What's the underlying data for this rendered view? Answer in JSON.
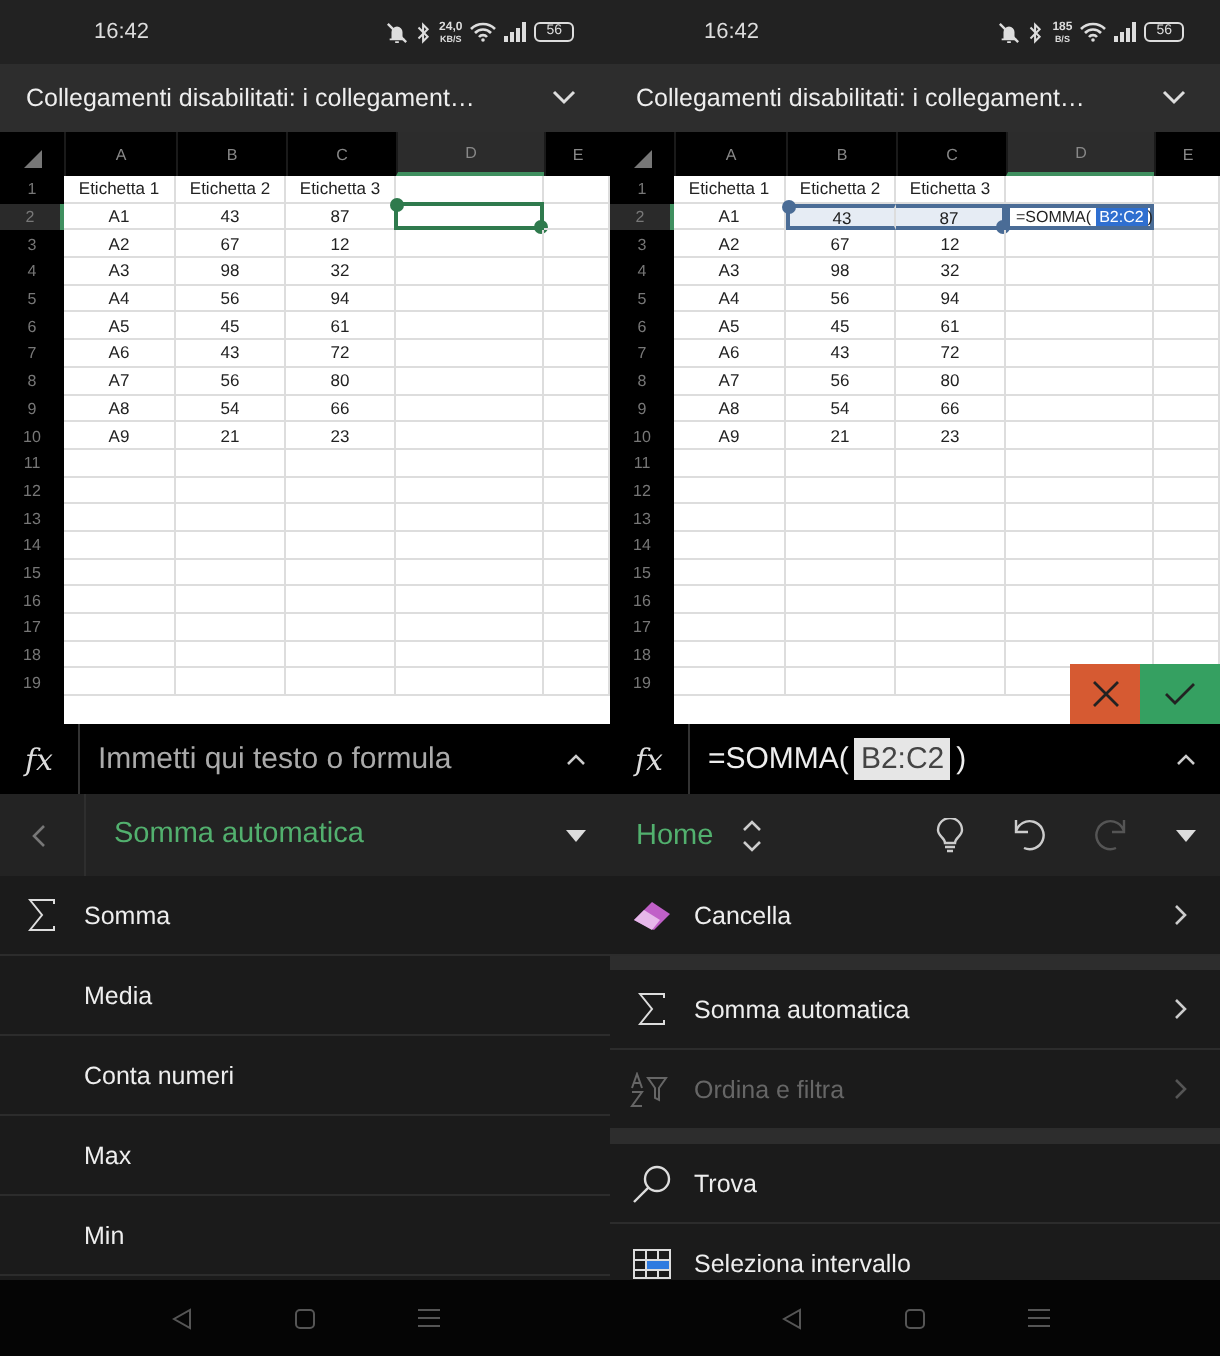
{
  "screens": [
    {
      "status_bar": {
        "time": "16:42",
        "speed_value": "24,0",
        "speed_unit": "KB/S",
        "battery": "56"
      },
      "banner": {
        "text": "Collegamenti disabilitati: i collegament…"
      },
      "sheet": {
        "editing": false,
        "columns": [
          {
            "label": "A",
            "selected": false
          },
          {
            "label": "B",
            "selected": false
          },
          {
            "label": "C",
            "selected": false
          },
          {
            "label": "D",
            "selected": true
          },
          {
            "label": "E",
            "selected": false
          }
        ],
        "rows": [
          {
            "number": "1",
            "selected": false,
            "cells": [
              {
                "text": "Etichetta 1",
                "selected": false
              },
              {
                "text": "Etichetta 2",
                "selected": false
              },
              {
                "text": "Etichetta 3",
                "selected": false
              }
            ]
          },
          {
            "number": "2",
            "selected": true,
            "cells": [
              {
                "text": "A1",
                "selected": false
              },
              {
                "text": "43",
                "selected": false
              },
              {
                "text": "87",
                "selected": false
              }
            ]
          },
          {
            "number": "3",
            "selected": false,
            "cells": [
              {
                "text": "A2",
                "selected": false
              },
              {
                "text": "67",
                "selected": false
              },
              {
                "text": "12",
                "selected": false
              }
            ]
          },
          {
            "number": "4",
            "selected": false,
            "cells": [
              {
                "text": "A3",
                "selected": false
              },
              {
                "text": "98",
                "selected": false
              },
              {
                "text": "32",
                "selected": false
              }
            ]
          },
          {
            "number": "5",
            "selected": false,
            "cells": [
              {
                "text": "A4",
                "selected": false
              },
              {
                "text": "56",
                "selected": false
              },
              {
                "text": "94",
                "selected": false
              }
            ]
          },
          {
            "number": "6",
            "selected": false,
            "cells": [
              {
                "text": "A5",
                "selected": false
              },
              {
                "text": "45",
                "selected": false
              },
              {
                "text": "61",
                "selected": false
              }
            ]
          },
          {
            "number": "7",
            "selected": false,
            "cells": [
              {
                "text": "A6",
                "selected": false
              },
              {
                "text": "43",
                "selected": false
              },
              {
                "text": "72",
                "selected": false
              }
            ]
          },
          {
            "number": "8",
            "selected": false,
            "cells": [
              {
                "text": "A7",
                "selected": false
              },
              {
                "text": "56",
                "selected": false
              },
              {
                "text": "80",
                "selected": false
              }
            ]
          },
          {
            "number": "9",
            "selected": false,
            "cells": [
              {
                "text": "A8",
                "selected": false
              },
              {
                "text": "54",
                "selected": false
              },
              {
                "text": "66",
                "selected": false
              }
            ]
          },
          {
            "number": "10",
            "selected": false,
            "cells": [
              {
                "text": "A9",
                "selected": false
              },
              {
                "text": "21",
                "selected": false
              },
              {
                "text": "23",
                "selected": false
              }
            ]
          },
          {
            "number": "11",
            "selected": false
          },
          {
            "number": "12",
            "selected": false
          },
          {
            "number": "13",
            "selected": false
          },
          {
            "number": "14",
            "selected": false
          },
          {
            "number": "15",
            "selected": false
          },
          {
            "number": "16",
            "selected": false
          },
          {
            "number": "17",
            "selected": false
          },
          {
            "number": "18",
            "selected": false
          },
          {
            "number": "19",
            "selected": false
          }
        ]
      },
      "formula_bar": {
        "label": "fx",
        "placeholder": "Immetti qui testo o formula"
      },
      "ribbon": {
        "kind": "submenu",
        "title": "Somma automatica"
      },
      "menu": {
        "groups": [
          {
            "items": [
              {
                "kind": "sigma",
                "label": "Somma",
                "submenu": false,
                "disabled": false
              },
              {
                "kind": "plain",
                "label": "Media",
                "submenu": false,
                "disabled": false
              },
              {
                "kind": "plain",
                "label": "Conta numeri",
                "submenu": false,
                "disabled": false
              },
              {
                "kind": "plain",
                "label": "Max",
                "submenu": false,
                "disabled": false
              },
              {
                "kind": "plain",
                "label": "Min",
                "submenu": false,
                "disabled": false
              }
            ]
          }
        ]
      }
    },
    {
      "status_bar": {
        "time": "16:42",
        "speed_value": "185",
        "speed_unit": "B/S",
        "battery": "56"
      },
      "banner": {
        "text": "Collegamenti disabilitati: i collegament…"
      },
      "sheet": {
        "editing": true,
        "columns": [
          {
            "label": "A",
            "selected": false
          },
          {
            "label": "B",
            "selected": false
          },
          {
            "label": "C",
            "selected": false
          },
          {
            "label": "D",
            "selected": true
          },
          {
            "label": "E",
            "selected": false
          }
        ],
        "rows": [
          {
            "number": "1",
            "selected": false,
            "cells": [
              {
                "text": "Etichetta 1",
                "selected": false
              },
              {
                "text": "Etichetta 2",
                "selected": false
              },
              {
                "text": "Etichetta 3",
                "selected": false
              }
            ]
          },
          {
            "number": "2",
            "selected": true,
            "cells": [
              {
                "text": "A1",
                "selected": false
              },
              {
                "text": "43",
                "selected": true
              },
              {
                "text": "87",
                "selected": true
              }
            ],
            "formula": {
              "start": "=SOMMA(",
              "reference": "B2:C2",
              "end": ")"
            }
          },
          {
            "number": "3",
            "selected": false,
            "cells": [
              {
                "text": "A2",
                "selected": false
              },
              {
                "text": "67",
                "selected": false
              },
              {
                "text": "12",
                "selected": false
              }
            ]
          },
          {
            "number": "4",
            "selected": false,
            "cells": [
              {
                "text": "A3",
                "selected": false
              },
              {
                "text": "98",
                "selected": false
              },
              {
                "text": "32",
                "selected": false
              }
            ]
          },
          {
            "number": "5",
            "selected": false,
            "cells": [
              {
                "text": "A4",
                "selected": false
              },
              {
                "text": "56",
                "selected": false
              },
              {
                "text": "94",
                "selected": false
              }
            ]
          },
          {
            "number": "6",
            "selected": false,
            "cells": [
              {
                "text": "A5",
                "selected": false
              },
              {
                "text": "45",
                "selected": false
              },
              {
                "text": "61",
                "selected": false
              }
            ]
          },
          {
            "number": "7",
            "selected": false,
            "cells": [
              {
                "text": "A6",
                "selected": false
              },
              {
                "text": "43",
                "selected": false
              },
              {
                "text": "72",
                "selected": false
              }
            ]
          },
          {
            "number": "8",
            "selected": false,
            "cells": [
              {
                "text": "A7",
                "selected": false
              },
              {
                "text": "56",
                "selected": false
              },
              {
                "text": "80",
                "selected": false
              }
            ]
          },
          {
            "number": "9",
            "selected": false,
            "cells": [
              {
                "text": "A8",
                "selected": false
              },
              {
                "text": "54",
                "selected": false
              },
              {
                "text": "66",
                "selected": false
              }
            ]
          },
          {
            "number": "10",
            "selected": false,
            "cells": [
              {
                "text": "A9",
                "selected": false
              },
              {
                "text": "21",
                "selected": false
              },
              {
                "text": "23",
                "selected": false
              }
            ]
          },
          {
            "number": "11",
            "selected": false
          },
          {
            "number": "12",
            "selected": false
          },
          {
            "number": "13",
            "selected": false
          },
          {
            "number": "14",
            "selected": false
          },
          {
            "number": "15",
            "selected": false
          },
          {
            "number": "16",
            "selected": false
          },
          {
            "number": "17",
            "selected": false
          },
          {
            "number": "18",
            "selected": false
          },
          {
            "number": "19",
            "selected": false
          }
        ]
      },
      "formula_bar": {
        "label": "fx",
        "start": "=SOMMA(",
        "reference": "B2:C2",
        "end": ")"
      },
      "ribbon": {
        "kind": "home",
        "title": "Home",
        "tools": [
          {
            "kind": "lightbulb",
            "disabled": false
          },
          {
            "kind": "undo",
            "disabled": false
          },
          {
            "kind": "redo",
            "disabled": true
          }
        ]
      },
      "menu": {
        "groups": [
          {
            "items": [
              {
                "kind": "eraser",
                "label": "Cancella",
                "submenu": true,
                "disabled": false
              }
            ]
          },
          {
            "items": [
              {
                "kind": "sigma",
                "label": "Somma automatica",
                "submenu": true,
                "disabled": false
              },
              {
                "kind": "sort",
                "label": "Ordina e filtra",
                "submenu": true,
                "disabled": true
              }
            ]
          },
          {
            "items": [
              {
                "kind": "search",
                "label": "Trova",
                "submenu": false,
                "disabled": false
              },
              {
                "kind": "grid",
                "label": "Seleziona intervallo",
                "submenu": false,
                "disabled": false
              }
            ]
          }
        ]
      }
    }
  ]
}
